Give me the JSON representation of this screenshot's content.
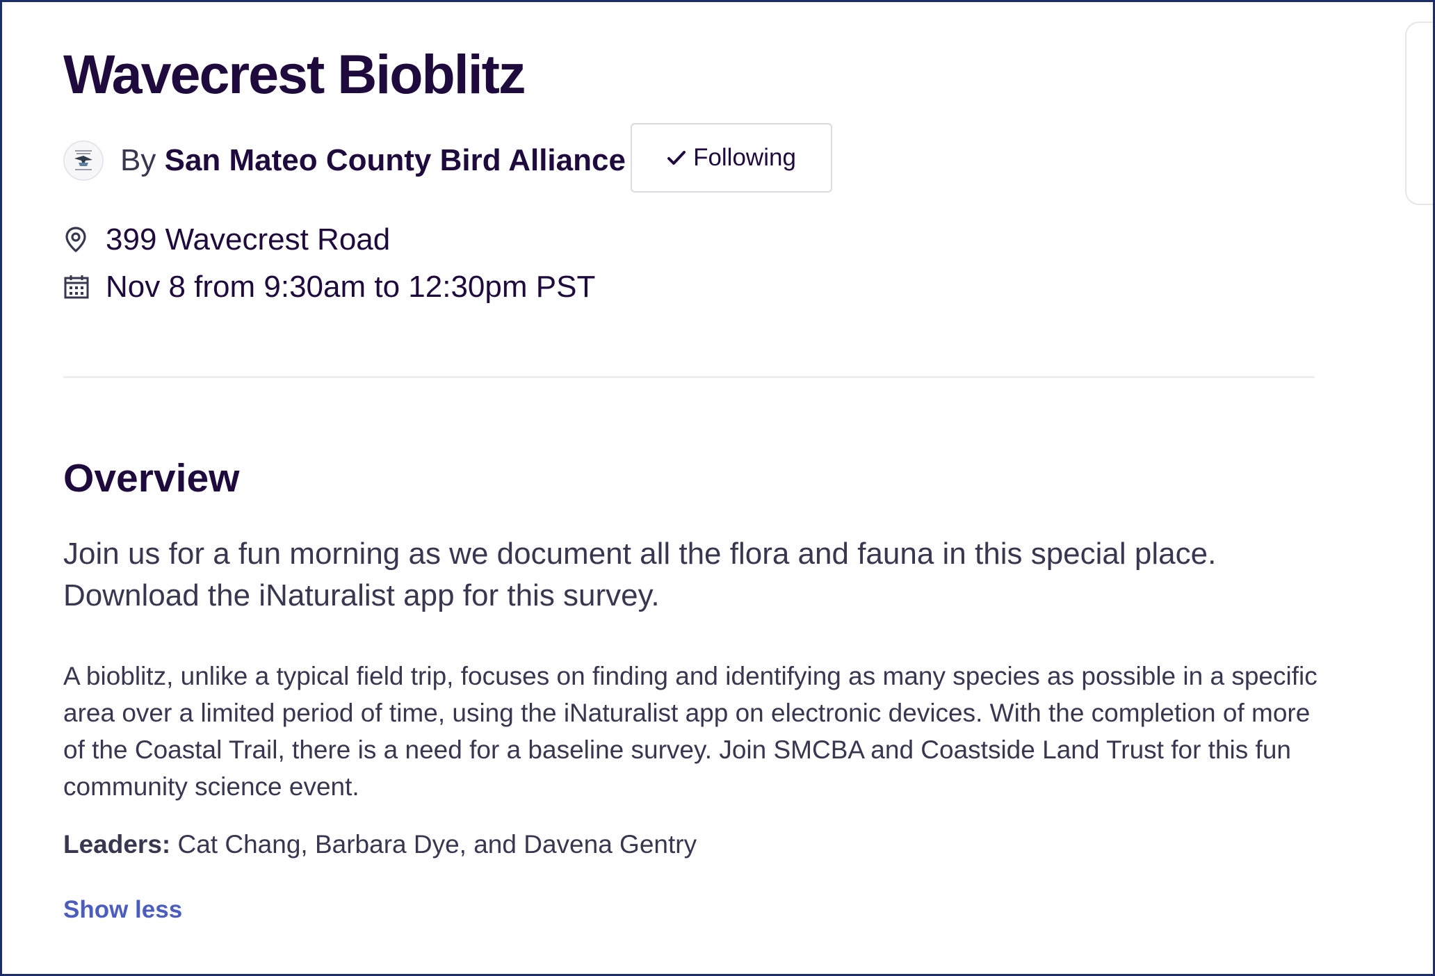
{
  "event": {
    "title": "Wavecrest Bioblitz",
    "organizer": {
      "by_label": "By",
      "name": "San Mateo County Bird Alliance",
      "logo_text": "SAN MATEO COUNTY BIRD ALLIANCE",
      "follow_label": "Following"
    },
    "location": "399 Wavecrest Road",
    "date_time": "Nov 8 from 9:30am to 12:30pm PST"
  },
  "overview": {
    "heading": "Overview",
    "summary": "Join us for a fun morning as we document all the flora and fauna in this special place. Download the iNaturalist app for this survey.",
    "description": "A bioblitz, unlike a typical field trip, focuses on finding and identifying as many species as possible in a specific area over a limited period of time, using the iNaturalist app on electronic devices. With the completion of more of the Coastal Trail, there is a need for a baseline survey. Join SMCBA and Coastside Land Trust for this fun community science event.",
    "leaders_label": "Leaders:",
    "leaders_names": " Cat Chang, Barbara Dye, and Davena Gentry",
    "show_less_label": "Show less"
  },
  "icons": {
    "location": "map-pin-icon",
    "date": "calendar-icon",
    "follow": "checkmark-icon"
  },
  "colors": {
    "title": "#1e0a3c",
    "body_text": "#39364f",
    "link": "#4b5dbe",
    "divider": "#eeedf2",
    "frame_border": "#1c2d6b"
  }
}
